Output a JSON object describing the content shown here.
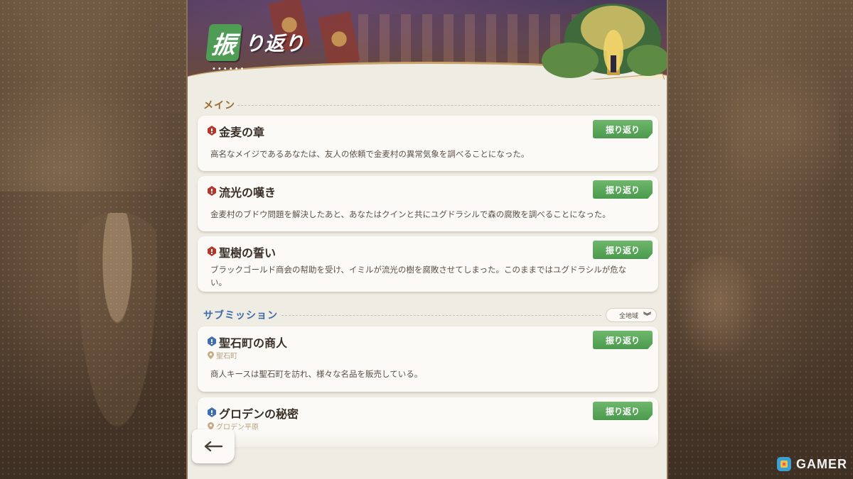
{
  "header": {
    "title_kanji": "振",
    "title_rest": "り返り",
    "title_dots": "••••••"
  },
  "sections": {
    "main_label": "メイン",
    "sub_label": "サブミッション"
  },
  "main_quests": [
    {
      "title": "金麦の章",
      "desc": "高名なメイジであるあなたは、友人の依頼で金麦村の異常気象を調べることになった。",
      "button": "振り返り"
    },
    {
      "title": "流光の嘆き",
      "desc": "金麦村のブドウ問題を解決したあと、あなたはクインと共にユグドラシルで森の腐敗を調べることになった。",
      "button": "振り返り"
    },
    {
      "title": "聖樹の誓い",
      "desc": "ブラックゴールド商会の幇助を受け、イミルが流光の樹を腐敗させてしまった。このままではユグドラシルが危ない。",
      "button": "振り返り"
    }
  ],
  "sub_quests": [
    {
      "title": "聖石町の商人",
      "location": "聖石町",
      "desc": "商人キースは聖石町を訪れ、様々な名品を販売している。",
      "button": "振り返り"
    },
    {
      "title": "グロデンの秘密",
      "location": "グロデン平原",
      "desc": "",
      "button": "振り返り"
    }
  ],
  "region_filter": {
    "selected": "全地域"
  },
  "colors": {
    "accent_green": "#4a9a4d",
    "main_icon": "#b5372c",
    "sub_icon": "#3f6fb3",
    "main_label": "#9a6a2e",
    "sub_label": "#3d6aa8"
  },
  "icons": {
    "back": "back-arrow-icon",
    "main_quest": "red-gem-icon",
    "sub_quest": "blue-gem-icon",
    "location": "location-pin-icon",
    "chevron": "double-chevron-down-icon"
  },
  "watermark": {
    "text": "GAMER"
  }
}
